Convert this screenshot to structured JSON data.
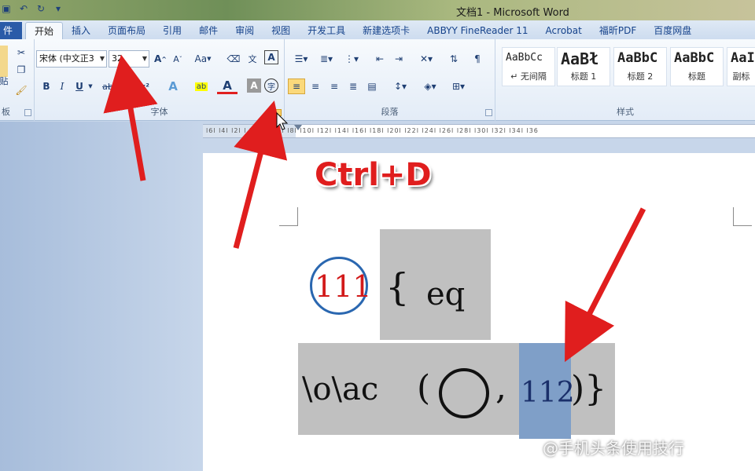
{
  "window": {
    "title": "文档1 - Microsoft Word"
  },
  "tabs": [
    "件",
    "开始",
    "插入",
    "页面布局",
    "引用",
    "邮件",
    "审阅",
    "视图",
    "开发工具",
    "新建选项卡",
    "ABBYY FineReader 11",
    "Acrobat",
    "福昕PDF",
    "百度网盘"
  ],
  "ribbon": {
    "clipboard": {
      "label": "板",
      "paste_char": "贴"
    },
    "font": {
      "label": "字体",
      "font_name": "宋体 (中文正3",
      "font_size": "32",
      "bold": "B",
      "italic": "I",
      "underline": "U",
      "strike": "abc",
      "superscript": "x²",
      "grow": "A",
      "shrink": "A",
      "case": "Aa"
    },
    "paragraph": {
      "label": "段落"
    },
    "styles": {
      "label": "样式",
      "items": [
        {
          "sample": "AaBbCc",
          "name": "↵ 无间隔"
        },
        {
          "sample": "AaBł",
          "name": "标题 1"
        },
        {
          "sample": "AaBbC",
          "name": "标题 2"
        },
        {
          "sample": "AaBbC",
          "name": "标题"
        },
        {
          "sample": "AaI",
          "name": "副标"
        }
      ]
    }
  },
  "ruler": {
    "numbers": "l6l  l4l  l2l   l  l2l  l4l  l6l  l8l  l10l  l12l  l14l  l16l  l18l  l20l  l22l  l24l  l26l  l28l  l30l  l32l  l34l  l36"
  },
  "document": {
    "circled_number": "111",
    "brace_open": "{",
    "field_code_1": "eq",
    "field_code_2": "\\o\\ac",
    "paren_open": "(",
    "comma": ",",
    "selected_number": "112",
    "close": ")}"
  },
  "annotation": {
    "shortcut": "Ctrl+D"
  },
  "watermark": "@手机头条使用技行",
  "colors": {
    "accent_red": "#e01e1e",
    "circle_blue": "#2a67b0",
    "selection": "#7f9fc8",
    "field_shade": "#c0c0c0"
  }
}
